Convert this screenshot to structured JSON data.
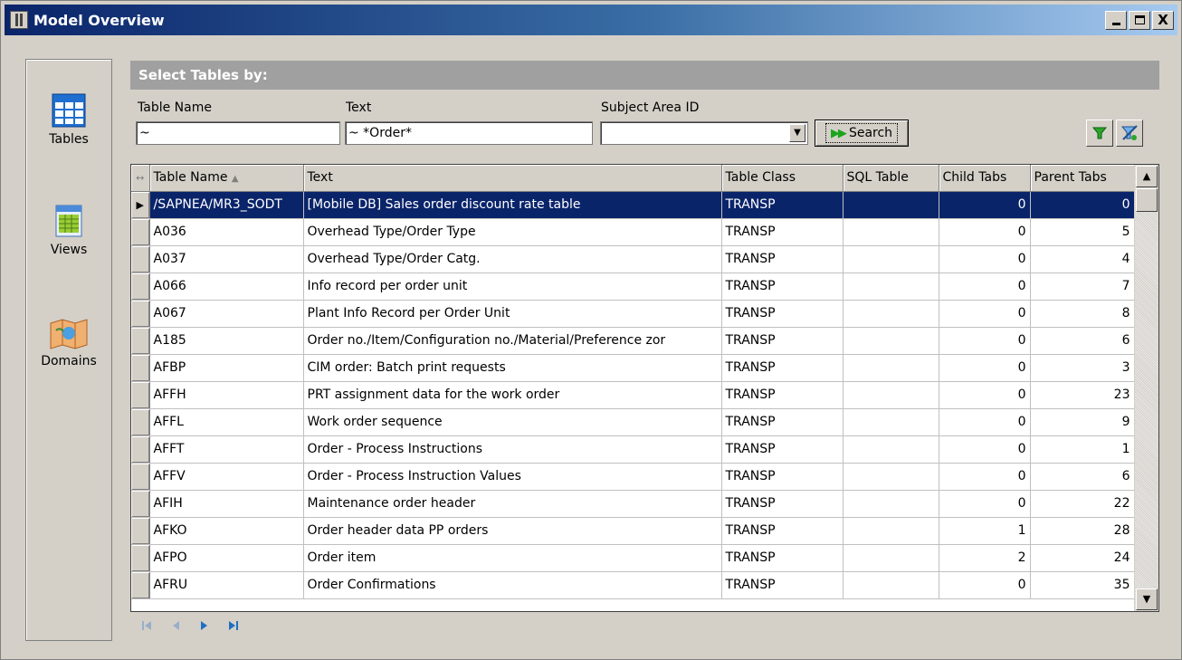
{
  "window": {
    "title": "Model Overview",
    "minimize_label": "",
    "close_label": "X"
  },
  "nav": {
    "items": [
      {
        "label": "Tables",
        "icon": "table-icon"
      },
      {
        "label": "Views",
        "icon": "view-icon"
      },
      {
        "label": "Domains",
        "icon": "domain-icon"
      }
    ]
  },
  "filter": {
    "header": "Select Tables by:",
    "table_name_label": "Table Name",
    "table_name_value": "~",
    "text_label": "Text",
    "text_value": "~  *Order*",
    "subject_area_label": "Subject Area ID",
    "subject_area_value": "",
    "search_label": "Search",
    "filter_icon": "funnel-icon",
    "clear_filter_icon": "funnel-clear-icon"
  },
  "grid": {
    "columns": [
      "Table Name",
      "Text",
      "Table Class",
      "SQL Table",
      "Child Tabs",
      "Parent Tabs"
    ],
    "sorted_column": "Table Name",
    "rows": [
      {
        "name": "/SAPNEA/MR3_SODT",
        "text": "[Mobile DB] Sales order discount rate table",
        "cls": "TRANSP",
        "sql": "",
        "child": "0",
        "parent": "0"
      },
      {
        "name": "A036",
        "text": "Overhead Type/Order Type",
        "cls": "TRANSP",
        "sql": "",
        "child": "0",
        "parent": "5"
      },
      {
        "name": "A037",
        "text": "Overhead Type/Order Catg.",
        "cls": "TRANSP",
        "sql": "",
        "child": "0",
        "parent": "4"
      },
      {
        "name": "A066",
        "text": "Info record per order unit",
        "cls": "TRANSP",
        "sql": "",
        "child": "0",
        "parent": "7"
      },
      {
        "name": "A067",
        "text": "Plant Info Record per Order Unit",
        "cls": "TRANSP",
        "sql": "",
        "child": "0",
        "parent": "8"
      },
      {
        "name": "A185",
        "text": "Order no./Item/Configuration no./Material/Preference zor",
        "cls": "TRANSP",
        "sql": "",
        "child": "0",
        "parent": "6"
      },
      {
        "name": "AFBP",
        "text": "CIM order: Batch print requests",
        "cls": "TRANSP",
        "sql": "",
        "child": "0",
        "parent": "3"
      },
      {
        "name": "AFFH",
        "text": "PRT assignment data for the work order",
        "cls": "TRANSP",
        "sql": "",
        "child": "0",
        "parent": "23"
      },
      {
        "name": "AFFL",
        "text": "Work order sequence",
        "cls": "TRANSP",
        "sql": "",
        "child": "0",
        "parent": "9"
      },
      {
        "name": "AFFT",
        "text": "Order - Process Instructions",
        "cls": "TRANSP",
        "sql": "",
        "child": "0",
        "parent": "1"
      },
      {
        "name": "AFFV",
        "text": "Order - Process Instruction Values",
        "cls": "TRANSP",
        "sql": "",
        "child": "0",
        "parent": "6"
      },
      {
        "name": "AFIH",
        "text": "Maintenance order header",
        "cls": "TRANSP",
        "sql": "",
        "child": "0",
        "parent": "22"
      },
      {
        "name": "AFKO",
        "text": "Order header data PP orders",
        "cls": "TRANSP",
        "sql": "",
        "child": "1",
        "parent": "28"
      },
      {
        "name": "AFPO",
        "text": "Order item",
        "cls": "TRANSP",
        "sql": "",
        "child": "2",
        "parent": "24"
      },
      {
        "name": "AFRU",
        "text": "Order Confirmations",
        "cls": "TRANSP",
        "sql": "",
        "child": "0",
        "parent": "35"
      }
    ],
    "selected_row": 0
  },
  "pager": {
    "icons": [
      "first-page-icon",
      "prev-page-icon",
      "next-page-icon",
      "last-page-icon"
    ]
  },
  "colors": {
    "selection": "#0a246a",
    "header_bar": "#a0a0a0",
    "accent_green": "#1aa51a",
    "pager_blue": "#1e6fc2"
  }
}
